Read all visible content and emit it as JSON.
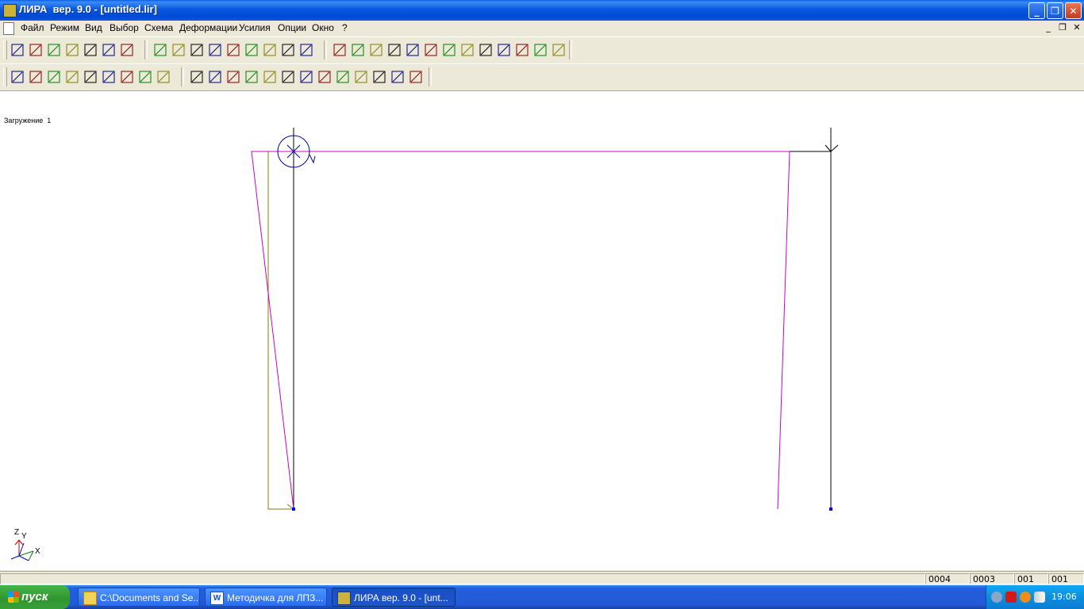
{
  "window": {
    "title": "ЛИРА  вер. 9.0 - [untitled.lir]",
    "minimize_glyph": "_",
    "restore_glyph": "❐",
    "close_glyph": "✕"
  },
  "menu": {
    "items": [
      "Файл",
      "Режим",
      "Вид",
      "Выбор",
      "Схема",
      "Деформации",
      "Усилия",
      "Опции",
      "Окно",
      "?"
    ],
    "mdi_minimize": "_",
    "mdi_restore": "❐",
    "mdi_close": "✕"
  },
  "toolbar1": {
    "icons": [
      "load-scheme-icon",
      "save-scheme-icon",
      "loads-icon",
      "deformation-x-icon",
      "deformation-y-icon",
      "deformation-z-icon",
      "normal-force-icon",
      "axes-xz-icon",
      "projection-xz-icon",
      "projection-yz-icon",
      "projection-xy-icon",
      "rotate-icon",
      "flag-icon",
      "pencil-icon",
      "zoom-in-icon",
      "zoom-window-icon",
      "filter-icon",
      "fragment-icon",
      "zoom-plus-icon",
      "zoom-minus-icon",
      "zoom-all-icon",
      "paint-icon",
      "marker-icon",
      "layers-icon",
      "notepad-icon",
      "palette-icon",
      "book-icon",
      "camera-icon",
      "help-icon"
    ]
  },
  "toolbar2": {
    "icons": [
      "frame-schema-1-icon",
      "frame-schema-2-icon",
      "frame-schema-3-icon",
      "moment-diagram-icon",
      "shear-diagram-icon",
      "deflection-diagram-icon",
      "rotation-diagram-icon",
      "ruler-icon",
      "leaf-icon",
      "grid-frame-icon",
      "mosaic-1-icon",
      "arch-icon",
      "mosaic-2-icon",
      "mosaic-3-icon",
      "mosaic-n-icon",
      "mosaic-m-icon",
      "numbers-12-icon",
      "page-icon",
      "bars-icon",
      "stress-icon",
      "bell-icon",
      "kv-icon"
    ]
  },
  "canvas": {
    "load_label": "Загружение  1",
    "axis_labels": {
      "z": "Z",
      "y": "Y",
      "x": "X"
    },
    "colors": {
      "structure": "#000000",
      "deformed": "#cc00cc",
      "diagram": "#808000",
      "support": "#0000ff",
      "load": "#0000aa"
    }
  },
  "statusbar": {
    "cells": [
      "0004",
      "0003",
      "001",
      "001"
    ]
  },
  "taskbar": {
    "start_label": "пуск",
    "tasks": [
      {
        "label": "C:\\Documents and Se...",
        "active": false
      },
      {
        "label": "Методичка для ЛПЗ...",
        "active": false
      },
      {
        "label": "ЛИРА  вер. 9.0 - [unt...",
        "active": true
      }
    ],
    "clock": "19:06"
  }
}
